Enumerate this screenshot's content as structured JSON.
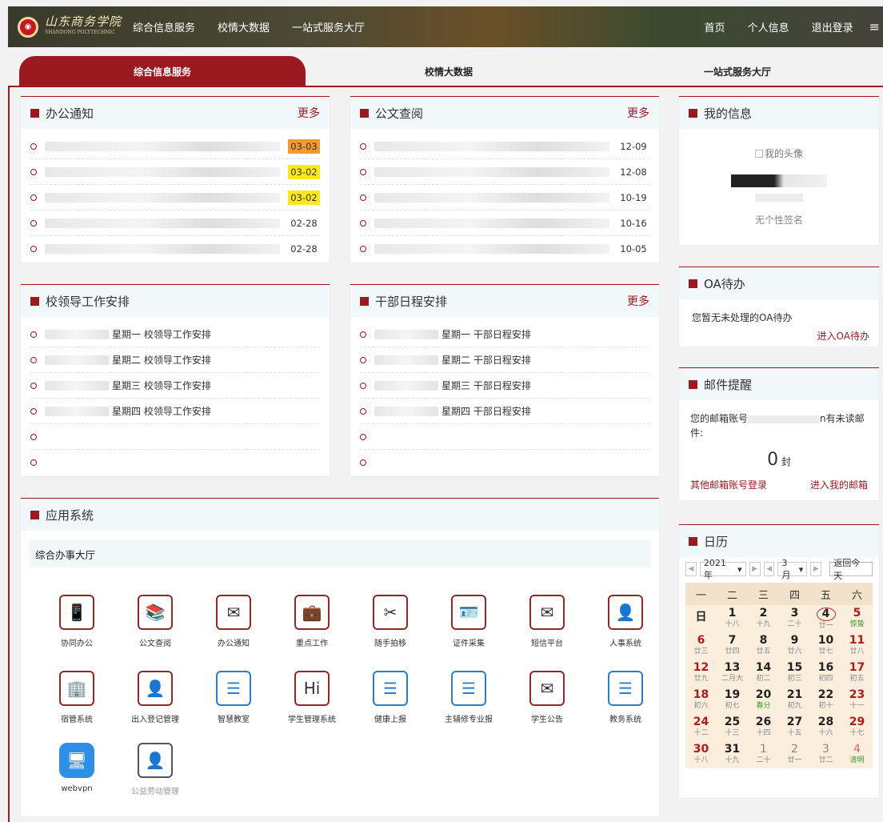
{
  "header": {
    "logo_text": "山东商务学院",
    "logo_sub": "SHANDONG POLYTECHNIC",
    "nav": [
      "综合信息服务",
      "校情大数据",
      "一站式服务大厅"
    ],
    "right": [
      "首页",
      "个人信息",
      "退出登录"
    ],
    "menu_icon": "≡"
  },
  "tabs": [
    "综合信息服务",
    "校情大数据",
    "一站式服务大厅"
  ],
  "office_notice": {
    "title": "办公通知",
    "more": "更多",
    "items": [
      {
        "date": "03-03",
        "color": "#f29a2e"
      },
      {
        "date": "03-02",
        "color": "#ffe818"
      },
      {
        "date": "03-02",
        "color": "#ffe818"
      },
      {
        "date": "02-28",
        "color": ""
      },
      {
        "date": "02-28",
        "color": ""
      }
    ]
  },
  "doc_review": {
    "title": "公文查阅",
    "more": "更多",
    "items": [
      "12-09",
      "12-08",
      "10-19",
      "10-16",
      "10-05"
    ]
  },
  "leader_schedule": {
    "title": "校领导工作安排",
    "items": [
      "星期一 校领导工作安排",
      "星期二 校领导工作安排",
      "星期三 校领导工作安排",
      "星期四 校领导工作安排",
      "",
      ""
    ]
  },
  "cadre_schedule": {
    "title": "干部日程安排",
    "more": "更多",
    "items": [
      "星期一 干部日程安排",
      "星期二 干部日程安排",
      "星期三 干部日程安排",
      "星期四 干部日程安排",
      "",
      ""
    ]
  },
  "my_info": {
    "title": "我的信息",
    "avatar_alt": "我的头像",
    "signature": "无个性签名"
  },
  "oa": {
    "title": "OA待办",
    "text": "您暂无未处理的OA待办",
    "link": "进入OA待办"
  },
  "mail": {
    "title": "邮件提醒",
    "text_prefix": "您的邮箱账号",
    "text_suffix": "n有未读邮件:",
    "count": "0",
    "unit": "封",
    "link_other": "其他邮箱账号登录",
    "link_enter": "进入我的邮箱"
  },
  "calendar": {
    "title": "日历",
    "year": "2021年",
    "month": "3月",
    "today_btn": "返回今天",
    "weekdays": [
      "一",
      "二",
      "三",
      "四",
      "五",
      "六",
      "日"
    ],
    "days": [
      {
        "n": "",
        "l": ""
      },
      {
        "n": "1",
        "l": "十八"
      },
      {
        "n": "2",
        "l": "十九"
      },
      {
        "n": "3",
        "l": "二十"
      },
      {
        "n": "4",
        "l": "廿一"
      },
      {
        "n": "5",
        "l": "惊蛰"
      },
      {
        "n": "",
        "l": ""
      },
      {
        "n": "6",
        "l": "廿三"
      },
      {
        "n": "7",
        "l": "廿四"
      },
      {
        "n": "8",
        "l": "廿五"
      },
      {
        "n": "9",
        "l": "廿六"
      },
      {
        "n": "10",
        "l": "廿七"
      },
      {
        "n": "11",
        "l": "廿八"
      },
      {
        "n": "",
        "l": ""
      },
      {
        "n": "12",
        "l": "廿九"
      },
      {
        "n": "13",
        "l": "二月大"
      },
      {
        "n": "14",
        "l": "初二"
      },
      {
        "n": "15",
        "l": "初三"
      },
      {
        "n": "16",
        "l": "初四"
      },
      {
        "n": "17",
        "l": "初五"
      },
      {
        "n": "",
        "l": ""
      },
      {
        "n": "18",
        "l": "初六"
      },
      {
        "n": "19",
        "l": "初七"
      },
      {
        "n": "20",
        "l": "春分"
      },
      {
        "n": "21",
        "l": "初九"
      },
      {
        "n": "22",
        "l": "初十"
      },
      {
        "n": "23",
        "l": "十一"
      },
      {
        "n": "",
        "l": ""
      },
      {
        "n": "24",
        "l": "十二"
      },
      {
        "n": "25",
        "l": "十三"
      },
      {
        "n": "26",
        "l": "十四"
      },
      {
        "n": "27",
        "l": "十五"
      },
      {
        "n": "28",
        "l": "十六"
      },
      {
        "n": "29",
        "l": "十七"
      },
      {
        "n": "",
        "l": ""
      },
      {
        "n": "30",
        "l": "十八"
      },
      {
        "n": "31",
        "l": "十九"
      },
      {
        "n": "1",
        "l": "二十"
      },
      {
        "n": "2",
        "l": "廿一"
      },
      {
        "n": "3",
        "l": "廿二"
      },
      {
        "n": "4",
        "l": "清明"
      },
      {
        "n": "",
        "l": ""
      }
    ]
  },
  "apps": {
    "title": "应用系统",
    "subtitle": "综合办事大厅",
    "items": [
      {
        "label": "协同办公",
        "icon": "📱",
        "style": ""
      },
      {
        "label": "公文查阅",
        "icon": "📚",
        "style": ""
      },
      {
        "label": "办公通知",
        "icon": "✉",
        "style": ""
      },
      {
        "label": "重点工作",
        "icon": "💼",
        "style": ""
      },
      {
        "label": "随手拍移",
        "icon": "✂",
        "style": ""
      },
      {
        "label": "证件采集",
        "icon": "🪪",
        "style": ""
      },
      {
        "label": "短信平台",
        "icon": "✉",
        "style": ""
      },
      {
        "label": "人事系统",
        "icon": "👤",
        "style": ""
      },
      {
        "label": "宿管系统",
        "icon": "🏢",
        "style": ""
      },
      {
        "label": "出入登记管理",
        "icon": "👤",
        "style": ""
      },
      {
        "label": "智慧教室",
        "icon": "☰",
        "style": "blue"
      },
      {
        "label": "学生管理系统",
        "icon": "Hi",
        "style": ""
      },
      {
        "label": "健康上报",
        "icon": "☰",
        "style": "blue"
      },
      {
        "label": "主辅修专业报",
        "icon": "☰",
        "style": "blue"
      },
      {
        "label": "学生公告",
        "icon": "✉",
        "style": ""
      },
      {
        "label": "教务系统",
        "icon": "☰",
        "style": "blue"
      },
      {
        "label": "webvpn",
        "icon": "🖥",
        "style": "solid"
      },
      {
        "label": "公益劳动管理",
        "icon": "👤",
        "style": "grey"
      }
    ]
  }
}
